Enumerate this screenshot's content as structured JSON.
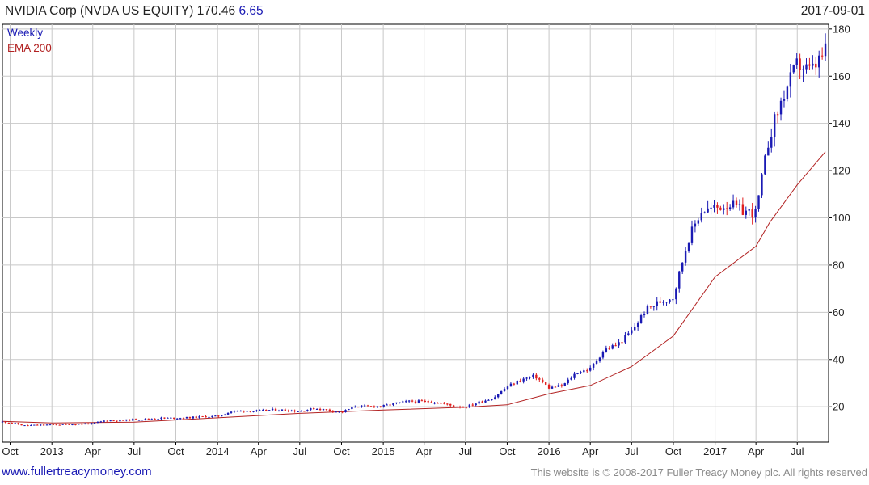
{
  "header": {
    "title": "NVIDIA Corp (NVDA US EQUITY) 170.46",
    "change": "6.65",
    "date": "2017-09-01"
  },
  "footer": {
    "site": "www.fullertreacymoney.com",
    "copyright": "This website is © 2008-2017 Fuller Treacy Money plc. All rights reserved"
  },
  "chart_data": {
    "type": "candlestick",
    "title": "NVIDIA Corp (NVDA US EQUITY) 170.46 6.65",
    "legend": [
      {
        "label": "Weekly",
        "color": "#1a1ab4"
      },
      {
        "label": "EMA 200",
        "color": "#b22222"
      }
    ],
    "legend_position": "top-left",
    "grid": true,
    "y_axis": {
      "position": "right",
      "range": [
        5,
        182
      ],
      "ticks": [
        20,
        40,
        60,
        80,
        100,
        120,
        140,
        160,
        180
      ]
    },
    "x_axis": {
      "range": [
        "2012-09-14",
        "2017-09-08"
      ],
      "ticks": [
        {
          "label": "Oct",
          "date": "2012-10-01"
        },
        {
          "label": "2013",
          "date": "2013-01-01"
        },
        {
          "label": "Apr",
          "date": "2013-04-01"
        },
        {
          "label": "Jul",
          "date": "2013-07-01"
        },
        {
          "label": "Oct",
          "date": "2013-10-01"
        },
        {
          "label": "2014",
          "date": "2014-01-01"
        },
        {
          "label": "Apr",
          "date": "2014-04-01"
        },
        {
          "label": "Jul",
          "date": "2014-07-01"
        },
        {
          "label": "Oct",
          "date": "2014-10-01"
        },
        {
          "label": "2015",
          "date": "2015-01-01"
        },
        {
          "label": "Apr",
          "date": "2015-04-01"
        },
        {
          "label": "Jul",
          "date": "2015-07-01"
        },
        {
          "label": "Oct",
          "date": "2015-10-01"
        },
        {
          "label": "2016",
          "date": "2016-01-01"
        },
        {
          "label": "Apr",
          "date": "2016-04-01"
        },
        {
          "label": "Jul",
          "date": "2016-07-01"
        },
        {
          "label": "Oct",
          "date": "2016-10-01"
        },
        {
          "label": "2017",
          "date": "2017-01-01"
        },
        {
          "label": "Apr",
          "date": "2017-04-01"
        },
        {
          "label": "Jul",
          "date": "2017-07-01"
        }
      ]
    },
    "price_series": {
      "name": "Weekly",
      "points": [
        [
          "2012-09-14",
          13.6
        ],
        [
          "2012-10-01",
          13.3
        ],
        [
          "2012-11-01",
          12.0
        ],
        [
          "2012-12-01",
          12.2
        ],
        [
          "2013-01-01",
          12.4
        ],
        [
          "2013-02-01",
          12.5
        ],
        [
          "2013-03-01",
          12.7
        ],
        [
          "2013-04-01",
          12.9
        ],
        [
          "2013-05-01",
          14.2
        ],
        [
          "2013-06-01",
          14.1
        ],
        [
          "2013-07-01",
          14.6
        ],
        [
          "2013-08-01",
          14.8
        ],
        [
          "2013-09-01",
          15.2
        ],
        [
          "2013-10-01",
          15.2
        ],
        [
          "2013-11-01",
          15.4
        ],
        [
          "2013-12-01",
          15.8
        ],
        [
          "2014-01-01",
          15.9
        ],
        [
          "2014-02-01",
          18.0
        ],
        [
          "2014-03-01",
          18.3
        ],
        [
          "2014-04-01",
          18.1
        ],
        [
          "2014-05-01",
          18.7
        ],
        [
          "2014-06-01",
          18.6
        ],
        [
          "2014-07-01",
          18.1
        ],
        [
          "2014-08-01",
          19.3
        ],
        [
          "2014-09-01",
          18.6
        ],
        [
          "2014-10-01",
          17.6
        ],
        [
          "2014-11-01",
          20.3
        ],
        [
          "2014-12-01",
          20.1
        ],
        [
          "2015-01-01",
          20.3
        ],
        [
          "2015-02-01",
          21.6
        ],
        [
          "2015-03-01",
          22.3
        ],
        [
          "2015-04-01",
          22.2
        ],
        [
          "2015-05-01",
          21.9
        ],
        [
          "2015-06-01",
          20.4
        ],
        [
          "2015-07-01",
          19.9
        ],
        [
          "2015-08-01",
          22.0
        ],
        [
          "2015-09-01",
          23.8
        ],
        [
          "2015-10-01",
          28.5
        ],
        [
          "2015-11-01",
          31.5
        ],
        [
          "2015-12-01",
          33.0
        ],
        [
          "2016-01-01",
          28.0
        ],
        [
          "2016-02-01",
          29.0
        ],
        [
          "2016-03-01",
          34.5
        ],
        [
          "2016-04-01",
          36.0
        ],
        [
          "2016-05-01",
          44.0
        ],
        [
          "2016-06-01",
          46.5
        ],
        [
          "2016-07-01",
          52.0
        ],
        [
          "2016-08-01",
          61.0
        ],
        [
          "2016-09-01",
          64.5
        ],
        [
          "2016-10-01",
          66.5
        ],
        [
          "2016-11-01",
          90.0
        ],
        [
          "2016-12-01",
          103.0
        ],
        [
          "2017-01-01",
          104.0
        ],
        [
          "2017-02-01",
          106.0
        ],
        [
          "2017-03-01",
          103.0
        ],
        [
          "2017-04-01",
          102.0
        ],
        [
          "2017-05-01",
          135.0
        ],
        [
          "2017-06-01",
          152.0
        ],
        [
          "2017-07-01",
          165.0
        ],
        [
          "2017-08-01",
          162.0
        ],
        [
          "2017-09-01",
          170.46
        ]
      ]
    },
    "ema_series": {
      "name": "EMA 200",
      "points": [
        [
          "2012-09-14",
          13.8
        ],
        [
          "2013-01-01",
          13.1
        ],
        [
          "2013-07-01",
          13.5
        ],
        [
          "2014-01-01",
          15.3
        ],
        [
          "2014-07-01",
          17.2
        ],
        [
          "2015-01-01",
          18.6
        ],
        [
          "2015-07-01",
          19.8
        ],
        [
          "2015-10-01",
          20.8
        ],
        [
          "2016-01-01",
          25.5
        ],
        [
          "2016-04-01",
          29.0
        ],
        [
          "2016-07-01",
          37.0
        ],
        [
          "2016-10-01",
          50.0
        ],
        [
          "2017-01-01",
          75.0
        ],
        [
          "2017-04-01",
          88.0
        ],
        [
          "2017-05-01",
          98.0
        ],
        [
          "2017-07-01",
          114.0
        ],
        [
          "2017-09-01",
          128.0
        ]
      ]
    }
  }
}
